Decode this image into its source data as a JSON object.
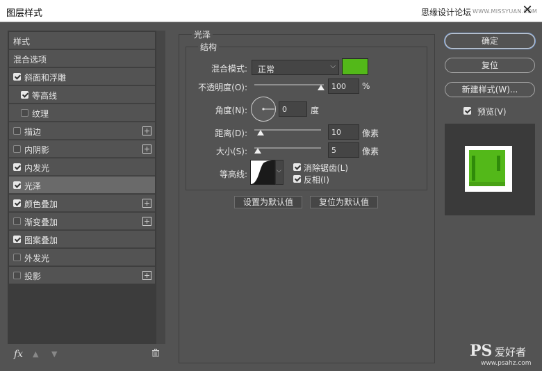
{
  "window": {
    "title": "图层样式",
    "watermark_text": "思缘设计论坛",
    "watermark_url": "WWW.MISSYUAN.COM",
    "close_glyph": "✕"
  },
  "styles_list": {
    "items": [
      {
        "label": "样式",
        "checkbox": false,
        "checked": false,
        "plus": false,
        "indent": 0,
        "selected": false
      },
      {
        "label": "混合选项",
        "checkbox": false,
        "checked": false,
        "plus": false,
        "indent": 0,
        "selected": false
      },
      {
        "label": "斜面和浮雕",
        "checkbox": true,
        "checked": true,
        "plus": false,
        "indent": 0,
        "selected": false
      },
      {
        "label": "等高线",
        "checkbox": true,
        "checked": true,
        "plus": false,
        "indent": 1,
        "selected": false
      },
      {
        "label": "纹理",
        "checkbox": true,
        "checked": false,
        "plus": false,
        "indent": 1,
        "selected": false
      },
      {
        "label": "描边",
        "checkbox": true,
        "checked": false,
        "plus": true,
        "indent": 0,
        "selected": false
      },
      {
        "label": "内阴影",
        "checkbox": true,
        "checked": false,
        "plus": true,
        "indent": 0,
        "selected": false
      },
      {
        "label": "内发光",
        "checkbox": true,
        "checked": true,
        "plus": false,
        "indent": 0,
        "selected": false
      },
      {
        "label": "光泽",
        "checkbox": true,
        "checked": true,
        "plus": false,
        "indent": 0,
        "selected": true
      },
      {
        "label": "颜色叠加",
        "checkbox": true,
        "checked": true,
        "plus": true,
        "indent": 0,
        "selected": false
      },
      {
        "label": "渐变叠加",
        "checkbox": true,
        "checked": false,
        "plus": true,
        "indent": 0,
        "selected": false
      },
      {
        "label": "图案叠加",
        "checkbox": true,
        "checked": true,
        "plus": false,
        "indent": 0,
        "selected": false
      },
      {
        "label": "外发光",
        "checkbox": true,
        "checked": false,
        "plus": false,
        "indent": 0,
        "selected": false
      },
      {
        "label": "投影",
        "checkbox": true,
        "checked": false,
        "plus": true,
        "indent": 0,
        "selected": false
      }
    ],
    "footer": {
      "fx_label": "fx",
      "up_glyph": "▲",
      "down_glyph": "▼"
    }
  },
  "satin": {
    "group_title": "光泽",
    "structure_title": "结构",
    "blend_mode_label": "混合模式:",
    "blend_mode_value": "正常",
    "color": "#53b819",
    "opacity_label": "不透明度(O):",
    "opacity_value": "100",
    "opacity_unit": "%",
    "angle_label": "角度(N):",
    "angle_value": "0",
    "angle_unit": "度",
    "distance_label": "距离(D):",
    "distance_value": "10",
    "distance_unit": "像素",
    "size_label": "大小(S):",
    "size_value": "5",
    "size_unit": "像素",
    "contour_label": "等高线:",
    "antialias_label": "消除锯齿(L)",
    "antialias_checked": true,
    "invert_label": "反相(I)",
    "invert_checked": true,
    "set_default": "设置为默认值",
    "reset_default": "复位为默认值"
  },
  "right_panel": {
    "ok": "确定",
    "reset": "复位",
    "new_style": "新建样式(W)...",
    "preview_label": "预览(V)",
    "preview_checked": true
  },
  "logo": {
    "text1": "PS",
    "text2": "爱好者",
    "url": "www.psahz.com"
  },
  "colors": {
    "accent_green": "#53b819",
    "panel_bg": "#535353"
  }
}
